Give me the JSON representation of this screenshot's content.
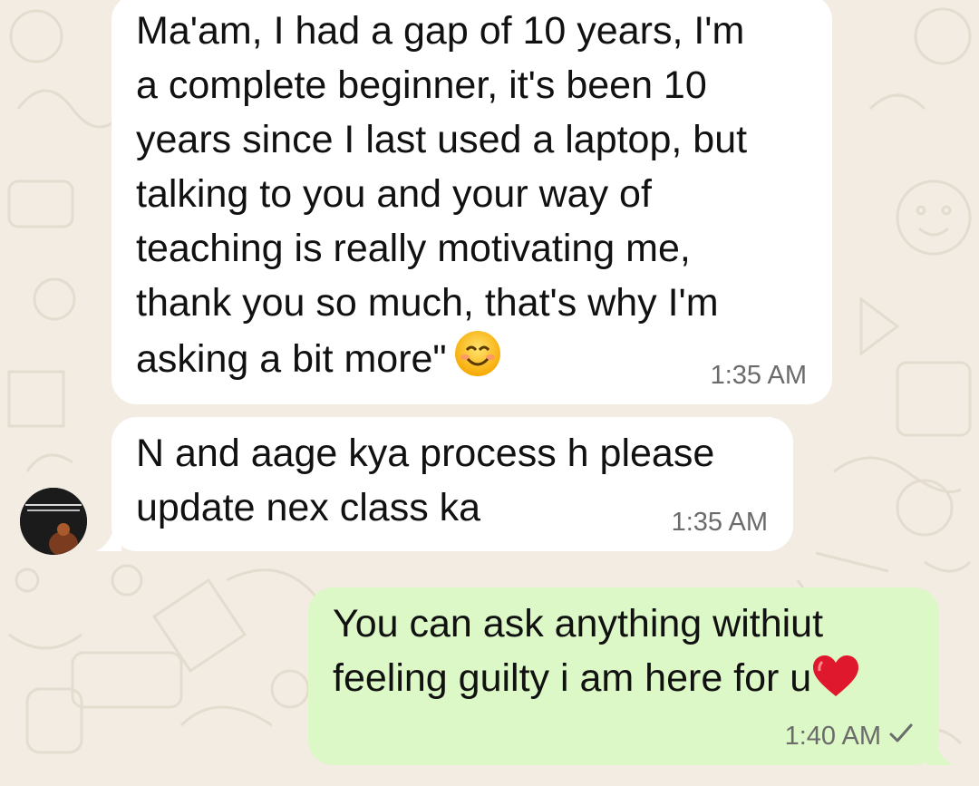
{
  "messages": [
    {
      "direction": "incoming",
      "text": "Ma'am, I had a gap of 10 years, I'm\na complete beginner, it's been 10\nyears since I last used a laptop, but\ntalking to you and your way of\nteaching is really motivating me,\nthank you so much, that's why I'm\nasking a bit more\"",
      "emoji": "smiling-face-icon",
      "time": "1:35 AM"
    },
    {
      "direction": "incoming",
      "text": "N and aage kya process h please\nupdate nex class ka",
      "time": "1:35 AM"
    },
    {
      "direction": "outgoing",
      "text": "You can ask anything withiut\nfeeling guilty i am here for u",
      "emoji": "red-heart-icon",
      "time": "1:40 AM",
      "status": "single-check-icon"
    }
  ],
  "colors": {
    "background": "#f2ece3",
    "incoming_bubble": "#ffffff",
    "outgoing_bubble": "#dcf8c6",
    "timestamp": "#6b6b6b"
  }
}
